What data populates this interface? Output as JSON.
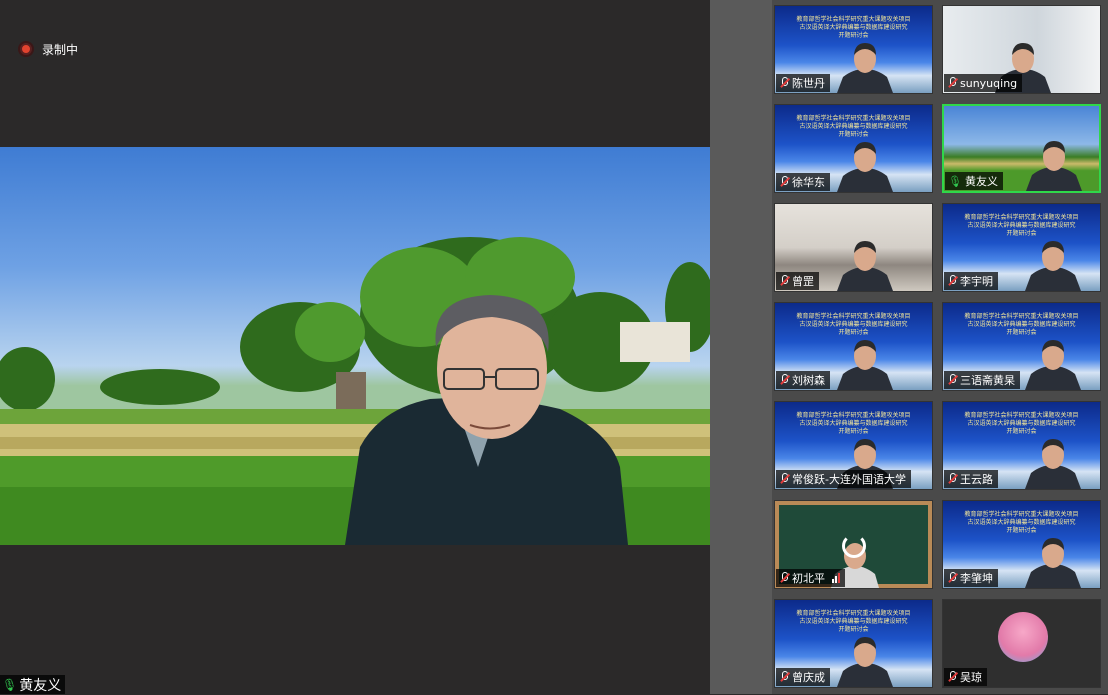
{
  "recording": {
    "label": "录制中"
  },
  "speaker": {
    "name": "黄友义"
  },
  "banner": {
    "line1": "教育部哲学社会科学研究重大课题攻关项目",
    "line2": "古汉语英译大辞典编纂与数据库建设研究",
    "line3": "开题研讨会"
  },
  "participants": [
    {
      "name": "陈世丹",
      "mic": "muted",
      "bg": "banner"
    },
    {
      "name": "sunyuqing",
      "mic": "muted",
      "bg": "office"
    },
    {
      "name": "徐华东",
      "mic": "muted",
      "bg": "banner"
    },
    {
      "name": "黄友义",
      "mic": "on",
      "bg": "field",
      "active": true
    },
    {
      "name": "曾罡",
      "mic": "muted",
      "bg": "shelf"
    },
    {
      "name": "李宇明",
      "mic": "muted",
      "bg": "banner"
    },
    {
      "name": "刘树森",
      "mic": "muted",
      "bg": "banner"
    },
    {
      "name": "三语斋黄杲",
      "mic": "muted",
      "bg": "banner"
    },
    {
      "name": "常俊跃-大连外国语大学",
      "mic": "muted",
      "bg": "banner"
    },
    {
      "name": "王云路",
      "mic": "muted",
      "bg": "banner"
    },
    {
      "name": "初北平",
      "mic": "muted",
      "bg": "board",
      "loading": true
    },
    {
      "name": "李肇坤",
      "mic": "muted",
      "bg": "banner"
    },
    {
      "name": "曾庆成",
      "mic": "muted",
      "bg": "banner"
    },
    {
      "name": "吴琼",
      "mic": "muted",
      "bg": "avatar"
    }
  ],
  "colors": {
    "active_border": "#2fd84a",
    "recording_dot": "#e2432f",
    "banner_text": "#f6e99a",
    "background": "#2b2929"
  }
}
